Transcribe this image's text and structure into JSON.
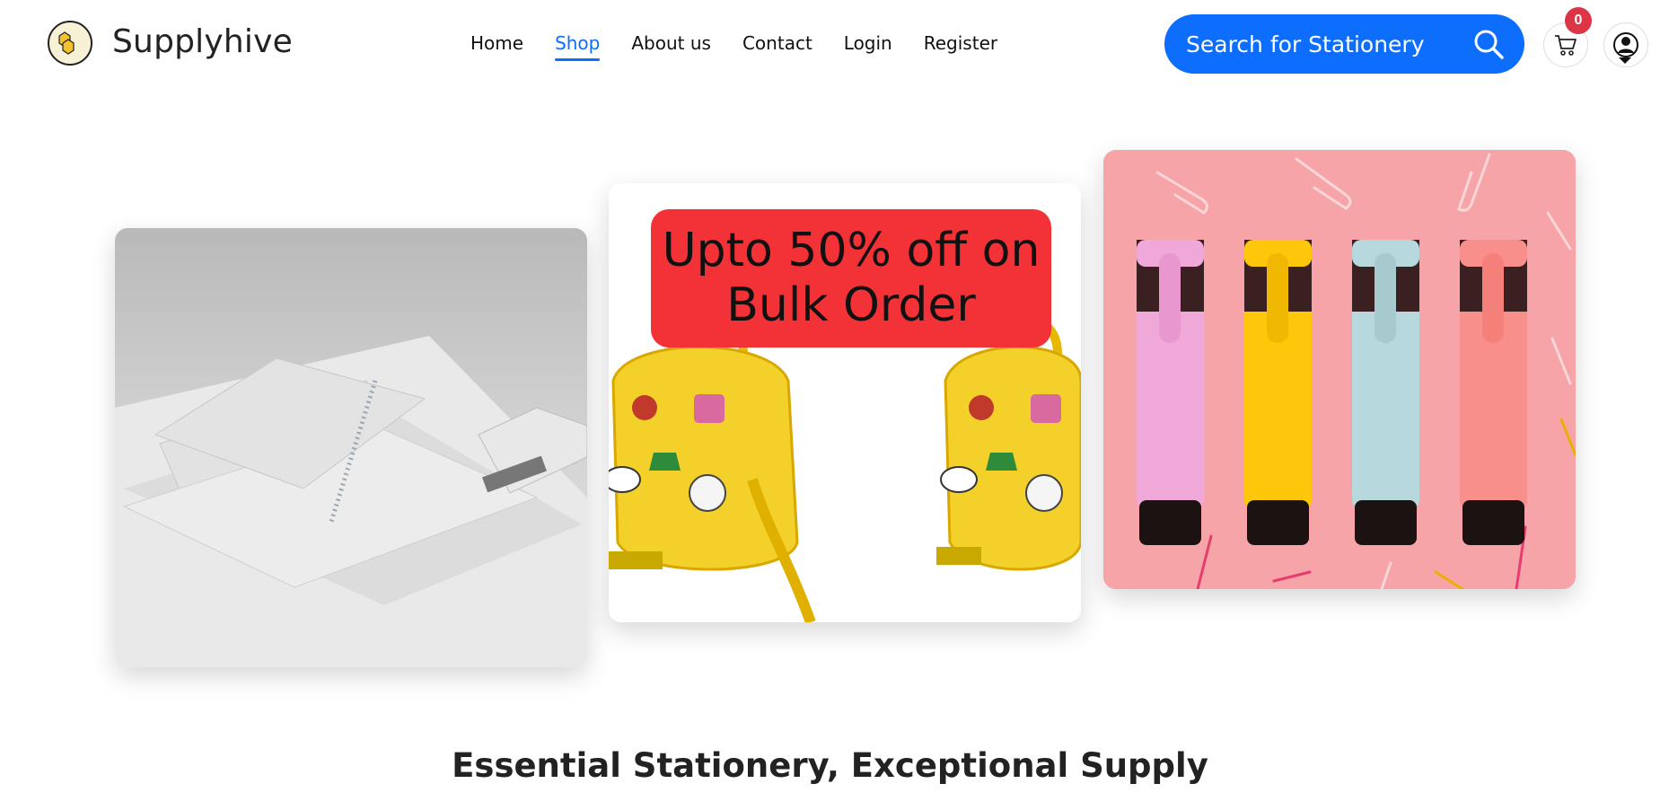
{
  "header": {
    "brand": "Supplyhive",
    "logo_text": "SUPPLY HIVE",
    "nav": [
      {
        "label": "Home",
        "active": false
      },
      {
        "label": "Shop",
        "active": true
      },
      {
        "label": "About us",
        "active": false
      },
      {
        "label": "Contact",
        "active": false
      },
      {
        "label": "Login",
        "active": false
      },
      {
        "label": "Register",
        "active": false
      }
    ],
    "search": {
      "label": "Search for Stationery",
      "icon": "search-icon"
    },
    "cart": {
      "icon": "cart-icon",
      "count": "0"
    },
    "user": {
      "icon": "user-icon"
    }
  },
  "carousel": {
    "slides": [
      {
        "alt": "Notebooks and stapler"
      },
      {
        "promo": "Upto 50% off on Bulk Order"
      },
      {
        "alt": "Pastel highlighters"
      }
    ]
  },
  "main": {
    "tagline": "Essential Stationery, Exceptional Supply"
  },
  "colors": {
    "accent": "#0d6efd",
    "badge": "#dc3545",
    "promo": "#f23236"
  }
}
